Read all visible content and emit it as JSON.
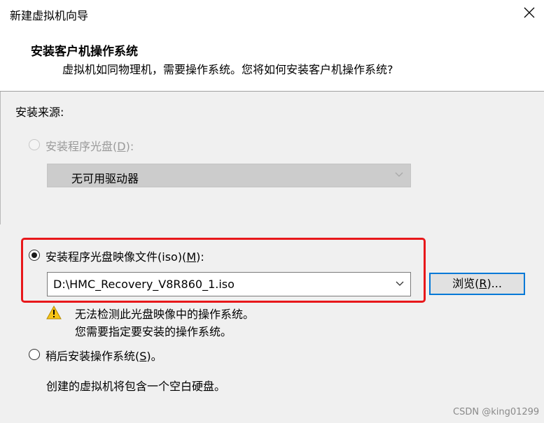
{
  "window": {
    "title": "新建虚拟机向导",
    "close_glyph": "✕"
  },
  "header": {
    "title": "安装客户机操作系统",
    "subtitle": "虚拟机如同物理机，需要操作系统。您将如何安装客户机操作系统?"
  },
  "install_source": {
    "label": "安装来源:",
    "disc_option": {
      "label_prefix": "安装程序光盘(",
      "accel": "D",
      "label_suffix": "):",
      "enabled": false,
      "drive_select_value": "无可用驱动器"
    },
    "iso_option": {
      "label_prefix": "安装程序光盘映像文件(iso)(",
      "accel": "M",
      "label_suffix": "):",
      "selected": true,
      "path_value": "D:\\HMC_Recovery_V8R860_1.iso",
      "browse_prefix": "浏览(",
      "browse_accel": "R",
      "browse_suffix": ")...",
      "highlight_color": "#e8181b"
    },
    "warning": {
      "icon": "warning-icon",
      "line1": "无法检测此光盘映像中的操作系统。",
      "line2": "您需要指定要安装的操作系统。"
    },
    "later_option": {
      "label_prefix": "稍后安装操作系统(",
      "accel": "S",
      "label_suffix": ")。",
      "selected": false,
      "description": "创建的虚拟机将包含一个空白硬盘。"
    }
  },
  "watermark": "CSDN @king01299"
}
